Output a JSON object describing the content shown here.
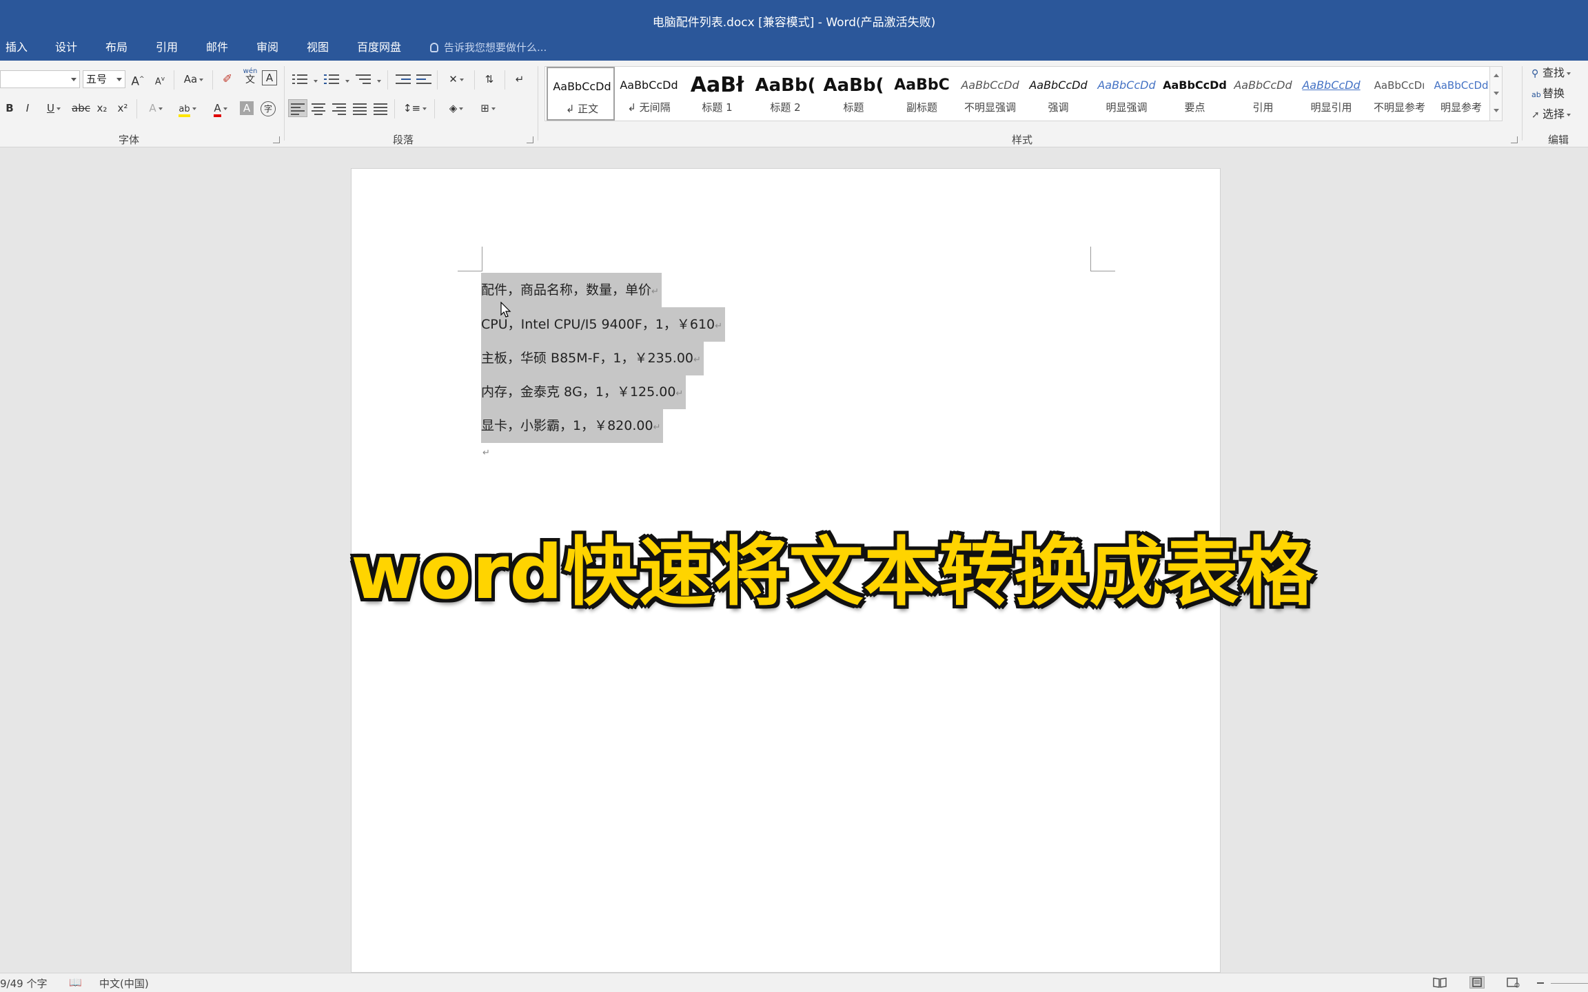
{
  "window": {
    "title": "电脑配件列表.docx [兼容模式] - Word(产品激活失败)"
  },
  "tabs": [
    "插入",
    "设计",
    "布局",
    "引用",
    "邮件",
    "审阅",
    "视图",
    "百度网盘"
  ],
  "tell_me": "告诉我您想要做什么...",
  "font_group": {
    "label": "字体",
    "font_name": "",
    "font_size": "五号",
    "grow": "A",
    "shrink": "A",
    "case": "Aa",
    "wen": "wén",
    "wen_char": "文",
    "border_a": "A",
    "bold": "B",
    "italic": "I",
    "underline": "U",
    "strike": "abc",
    "sub": "x₂",
    "sup": "x²",
    "text_effect": "A",
    "highlight": "ab",
    "font_color": "A",
    "char_shade": "A",
    "enclose": "字"
  },
  "paragraph_group": {
    "label": "段落"
  },
  "styles_group": {
    "label": "样式",
    "items": [
      {
        "sample": "AaBbCcDd",
        "name": "↲ 正文"
      },
      {
        "sample": "AaBbCcDd",
        "name": "↲ 无间隔"
      },
      {
        "sample": "AaBł",
        "name": "标题 1"
      },
      {
        "sample": "AaBb(",
        "name": "标题 2"
      },
      {
        "sample": "AaBb(",
        "name": "标题"
      },
      {
        "sample": "AaBbC",
        "name": "副标题"
      },
      {
        "sample": "AaBbCcDd",
        "name": "不明显强调"
      },
      {
        "sample": "AaBbCcDd",
        "name": "强调"
      },
      {
        "sample": "AaBbCcDd",
        "name": "明显强调"
      },
      {
        "sample": "AaBbCcDd",
        "name": "要点"
      },
      {
        "sample": "AaBbCcDd",
        "name": "引用"
      },
      {
        "sample": "AaBbCcDd",
        "name": "明显引用"
      },
      {
        "sample": "AaBbCcDı",
        "name": "不明显参考"
      },
      {
        "sample": "AaBbCcDd",
        "name": "明显参考"
      }
    ]
  },
  "editing_group": {
    "label": "编辑",
    "find": "查找",
    "replace": "替换",
    "select": "选择"
  },
  "document": {
    "lines": [
      "配件，商品名称，数量，单价",
      "CPU，Intel CPU/I5 9400F，1，￥610",
      "主板，华硕 B85M-F，1，￥235.00",
      "内存，金泰克 8G，1，￥125.00",
      "显卡，小影霸，1，￥820.00"
    ],
    "para_mark": "↵"
  },
  "overlay_caption": "word快速将文本转换成表格",
  "status_bar": {
    "word_count": "9/49 个字",
    "language": "中文(中国)"
  },
  "colors": {
    "title_bar": "#2b579a",
    "selection": "#c6c6c6",
    "caption": "#ffd400"
  }
}
